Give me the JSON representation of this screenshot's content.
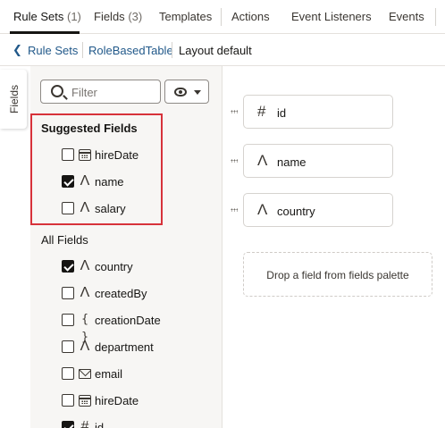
{
  "tabs": [
    {
      "label": "Rule Sets",
      "count": "(1)"
    },
    {
      "label": "Fields",
      "count": "(3)"
    },
    {
      "label": "Templates",
      "count": ""
    },
    {
      "label": "Actions",
      "count": ""
    },
    {
      "label": "Event Listeners",
      "count": ""
    },
    {
      "label": "Events",
      "count": ""
    }
  ],
  "breadcrumb": {
    "back": "Rule Sets",
    "table": "RoleBasedTable",
    "current": "Layout default"
  },
  "side_tab": "Fields",
  "filter": {
    "placeholder": "Filter"
  },
  "suggested": {
    "title": "Suggested Fields",
    "items": [
      {
        "label": "hireDate",
        "icon": "calendar-icon",
        "checked": false
      },
      {
        "label": "name",
        "icon": "text-type-icon",
        "checked": true
      },
      {
        "label": "salary",
        "icon": "text-type-icon",
        "checked": false
      }
    ]
  },
  "all_fields": {
    "title": "All Fields",
    "items": [
      {
        "label": "country",
        "icon": "text-type-icon",
        "checked": true
      },
      {
        "label": "createdBy",
        "icon": "text-type-icon",
        "checked": false
      },
      {
        "label": "creationDate",
        "icon": "braces-icon",
        "checked": false
      },
      {
        "label": "department",
        "icon": "text-type-icon",
        "checked": false
      },
      {
        "label": "email",
        "icon": "mail-icon",
        "checked": false
      },
      {
        "label": "hireDate",
        "icon": "calendar-icon",
        "checked": false
      },
      {
        "label": "id",
        "icon": "number-icon",
        "checked": true
      }
    ]
  },
  "layout": {
    "cards": [
      {
        "label": "id",
        "icon": "number-icon"
      },
      {
        "label": "name",
        "icon": "text-type-icon"
      },
      {
        "label": "country",
        "icon": "text-type-icon"
      }
    ],
    "drop_text": "Drop a field from fields palette"
  },
  "colors": {
    "highlight": "#d7323a",
    "link": "#22598a"
  }
}
